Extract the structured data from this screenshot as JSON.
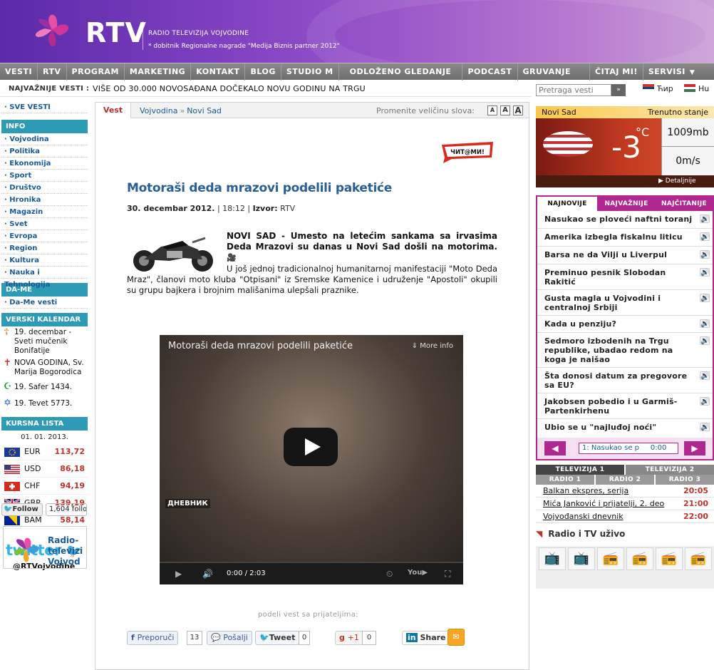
{
  "header": {
    "logo": "RTV",
    "sub1": "RADIO TELEVIZIJA VOJVODINE",
    "sub2": "* dobitnik Regionalne nagrade \"Medija Biznis partner 2012\""
  },
  "nav": [
    "VESTI",
    "RTV",
    "PROGRAM",
    "MARKETING",
    "KONTAKT",
    "BLOG",
    "STUDIO M",
    "ODLOŽENO GLEDANJE",
    "PODCAST",
    "GRUVANJE",
    "ČITAJ MI!",
    "SERVISI"
  ],
  "ticker": {
    "label": "NAJVAŽNIJE VESTI :",
    "text": "VIŠE OD 30.000 NOVOSAĐANA DOČEKALO NOVU GODINU NA TRGU"
  },
  "search": {
    "placeholder": "Pretraga vesti",
    "btn": "»"
  },
  "lang": {
    "cyr": "Ћир",
    "hu": "Hu"
  },
  "left": {
    "all_news": "SVE VESTI",
    "info_head": "INFO",
    "info_links": [
      "Vojvodina",
      "Politika",
      "Ekonomija",
      "Sport",
      "Društvo",
      "Hronika",
      "Magazin",
      "Svet",
      "Evropa",
      "Region",
      "Kultura",
      "Nauka i Tehnologija"
    ],
    "dame_head": "DA-ME",
    "dame_links": [
      "Da-Me vesti"
    ],
    "cal_head": "VERSKI KALENDAR",
    "calendar": [
      {
        "icon": "☦",
        "color": "#d08020",
        "text": "19. decembar - Sveti mučenik Bonifatije"
      },
      {
        "icon": "✝",
        "color": "#c0322a",
        "text": "NOVA GODINA, Sv. Marija Bogorodica"
      },
      {
        "icon": "☪",
        "color": "#1c9a3a",
        "text": "19. Safer 1434."
      },
      {
        "icon": "✡",
        "color": "#2a5eb6",
        "text": "19. Tevet 5773."
      }
    ],
    "fx_head": "KURSNA LISTA",
    "fx_date": "01. 01. 2013.",
    "fx": [
      {
        "cur": "EUR",
        "val": "113,72"
      },
      {
        "cur": "USD",
        "val": "86,18"
      },
      {
        "cur": "CHF",
        "val": "94,19"
      },
      {
        "cur": "GBP",
        "val": "139,19"
      },
      {
        "cur": "BAM",
        "val": "58,14"
      }
    ],
    "twitter": "twitter",
    "twitter_handle": "@RTVojvodine",
    "follow_btn": "Follow",
    "follow_count": "1,604 follo",
    "fb_name": "Radio-\ntelevizi\nVojvod"
  },
  "main": {
    "tab": "Vest",
    "crumb1": "Vojvodina",
    "crumb_sep": "»",
    "crumb2": "Novi Sad",
    "font_label": "Promenite veličinu slova:",
    "font_btns": [
      "A",
      "A",
      "A"
    ],
    "citaj": "ЧИТ@МИ!",
    "title": "Motoraši deda mrazovi podelili paketiće",
    "date": "30. decembar 2012.",
    "time": "| 18:12 |",
    "source_lbl": "Izvor:",
    "source": "RTV",
    "lead": "NOVI SAD - Umesto na letećim sankama sa irvasima Deda Mrazovi su danas u Novi Sad došli na motorima.",
    "body": "U još jednoj tradicionalnoj humanitarnoj manifestaciji \"Moto Deda Mraz\", članovi moto kluba \"Otpisani\" iz Sremske Kamenice i udruženje \"Apostoli\" okupili su grupu bajkera i brojnim mališanima ulepšali praznike.",
    "video_title": "Motoraši deda mrazovi podelili paketiće",
    "video_more": "More info",
    "video_time": "0:00 / 2:03",
    "video_logo": "ДНЕВНИК",
    "share_label": "podeli vest sa prijateljima:",
    "fb_share": "Preporuči",
    "fb_count": "13",
    "send": "Pošalji",
    "tweet": "Tweet",
    "tweet_count": "0",
    "gplus": "+1",
    "gplus_count": "0",
    "li_share": "Share"
  },
  "weather": {
    "city": "Novi Sad",
    "state": "Trenutno stanje",
    "temp": "-3",
    "unit": "°C",
    "pressure": "1009mb",
    "wind": "0m/s",
    "details": "▶ Detaljnije"
  },
  "newsbox": {
    "tabs": [
      "NAJNOVIJE",
      "NAJVAŽNIJE",
      "NAJČITANIJE"
    ],
    "items": [
      "Nasukao se ploveći naftni toranj",
      "Amerika izbegla fiskalnu liticu",
      "Barsa ne da Vilji u Liverpul",
      "Preminuo pesnik Slobodan Rakitić",
      "Gusta magla u Vojvodini i centralnoj Srbiji",
      "Kada u penziju?",
      "Sedmoro izbodenih na Trgu republike, ubadao redom na koga je naišao",
      "Šta donosi datum za pregovore sa EU?",
      "Jakobsen pobedio i u Garmiš-Partenkirhenu",
      "Ubio se u \"najluđoj noći\""
    ],
    "status": "1: Nasukao se p",
    "status_time": "0:00"
  },
  "tv": {
    "tabs1": [
      "TELEVIZIJA 1",
      "TELEVIZIJA 2"
    ],
    "tabs2": [
      "RADIO 1",
      "RADIO 2",
      "RADIO 3"
    ],
    "rows": [
      {
        "show": "Balkan ekspres, serija",
        "time": "20:05"
      },
      {
        "show": "Mića Janković i prijatelji, 2. deo",
        "time": "21:00"
      },
      {
        "show": "Vojvođanski dnevnik",
        "time": "22:00"
      }
    ],
    "live": "Radio i TV uživo"
  }
}
